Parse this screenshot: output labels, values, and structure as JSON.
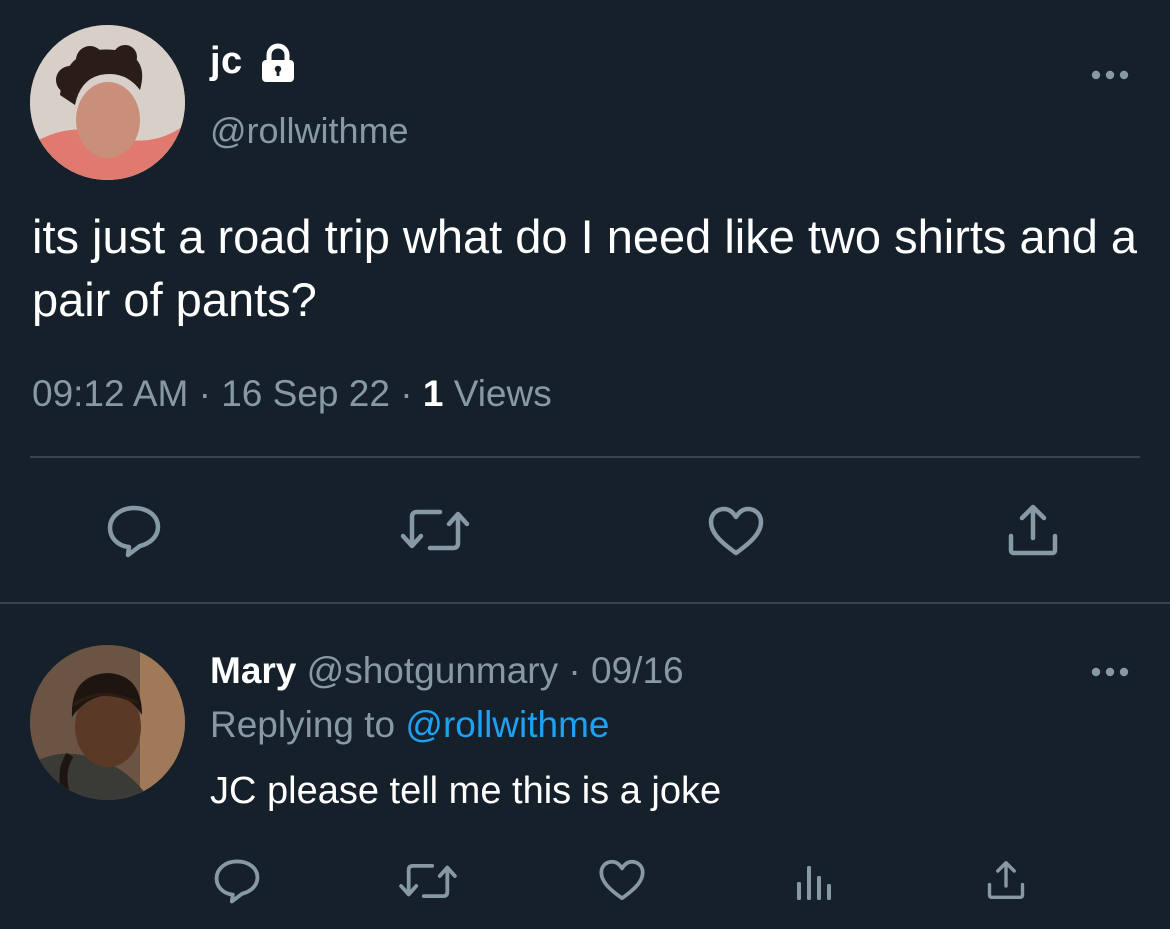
{
  "main_tweet": {
    "display_name": "jc",
    "handle": "@rollwithme",
    "text": "its just a road trip what do I need like two shirts and a pair of pants?",
    "time": "09:12 AM",
    "date": "16 Sep 22",
    "views_count": "1",
    "views_label": "Views",
    "separator": " · ",
    "icons": {
      "lock": "lock-icon",
      "more": "more-horizontal-icon",
      "reply": "reply-icon",
      "retweet": "retweet-icon",
      "like": "heart-icon",
      "share": "share-icon"
    }
  },
  "reply_tweet": {
    "display_name": "Mary",
    "handle": "@shotgunmary",
    "date": "09/16",
    "replying_to_label": "Replying to",
    "replying_to_handle": "@rollwithme",
    "text": "JC please tell me this is a joke",
    "separator": " · ",
    "icons": {
      "more": "more-horizontal-icon",
      "reply": "reply-icon",
      "retweet": "retweet-icon",
      "like": "heart-icon",
      "analytics": "analytics-icon",
      "share": "share-icon"
    }
  },
  "colors": {
    "background": "#15202b",
    "primary_text": "#ffffff",
    "secondary_text": "#8899a6",
    "link": "#1da1f2",
    "divider": "#38444d"
  }
}
